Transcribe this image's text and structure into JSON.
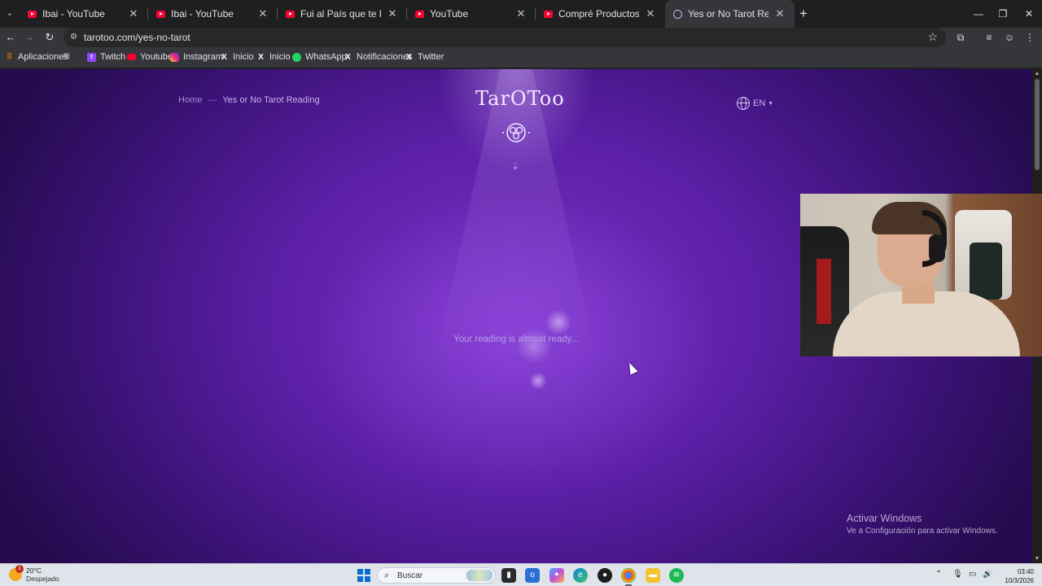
{
  "browser": {
    "tabs": [
      {
        "title": "Ibai - YouTube",
        "favicon": "youtube-icon",
        "active": false
      },
      {
        "title": "Ibai - YouTube",
        "favicon": "youtube-icon",
        "active": false
      },
      {
        "title": "Fui al País que te Paga por Visit",
        "favicon": "youtube-icon",
        "active": false
      },
      {
        "title": "YouTube",
        "favicon": "youtube-icon",
        "active": false
      },
      {
        "title": "Compré Productos que Nadie C",
        "favicon": "youtube-icon",
        "active": false
      },
      {
        "title": "Yes or No Tarot Reading | Tarot",
        "favicon": "tarotoo-icon",
        "active": true
      }
    ],
    "url": "tarotoo.com/yes-no-tarot",
    "bookmarks": [
      {
        "label": "Aplicaciones",
        "icon": "apps-icon"
      },
      {
        "label": "",
        "icon": "grid-icon"
      },
      {
        "label": "Twitch",
        "icon": "twitch-icon"
      },
      {
        "label": "Youtube",
        "icon": "youtube-icon"
      },
      {
        "label": "Instagram",
        "icon": "instagram-icon"
      },
      {
        "label": "Inicio",
        "icon": "x-icon"
      },
      {
        "label": "Inicio",
        "icon": "x-icon"
      },
      {
        "label": "WhatsApp",
        "icon": "whatsapp-icon"
      },
      {
        "label": "Notificaciones",
        "icon": "x-icon"
      },
      {
        "label": "Twitter",
        "icon": "x-icon"
      }
    ]
  },
  "page": {
    "breadcrumb": {
      "home": "Home",
      "separator": "—",
      "current": "Yes or No Tarot Reading"
    },
    "logo": "TarOToo",
    "language": "EN",
    "loading_text": "Your reading is almost ready...",
    "accent_color": "#5a1ea3"
  },
  "watermark": {
    "line1": "Activar Windows",
    "line2": "Ve a Configuración para activar Windows."
  },
  "taskbar": {
    "weather": {
      "temp": "20°C",
      "condition": "Despejado",
      "badge": "1"
    },
    "search_placeholder": "Buscar",
    "time": "03:40",
    "date": "10/3/2026"
  }
}
